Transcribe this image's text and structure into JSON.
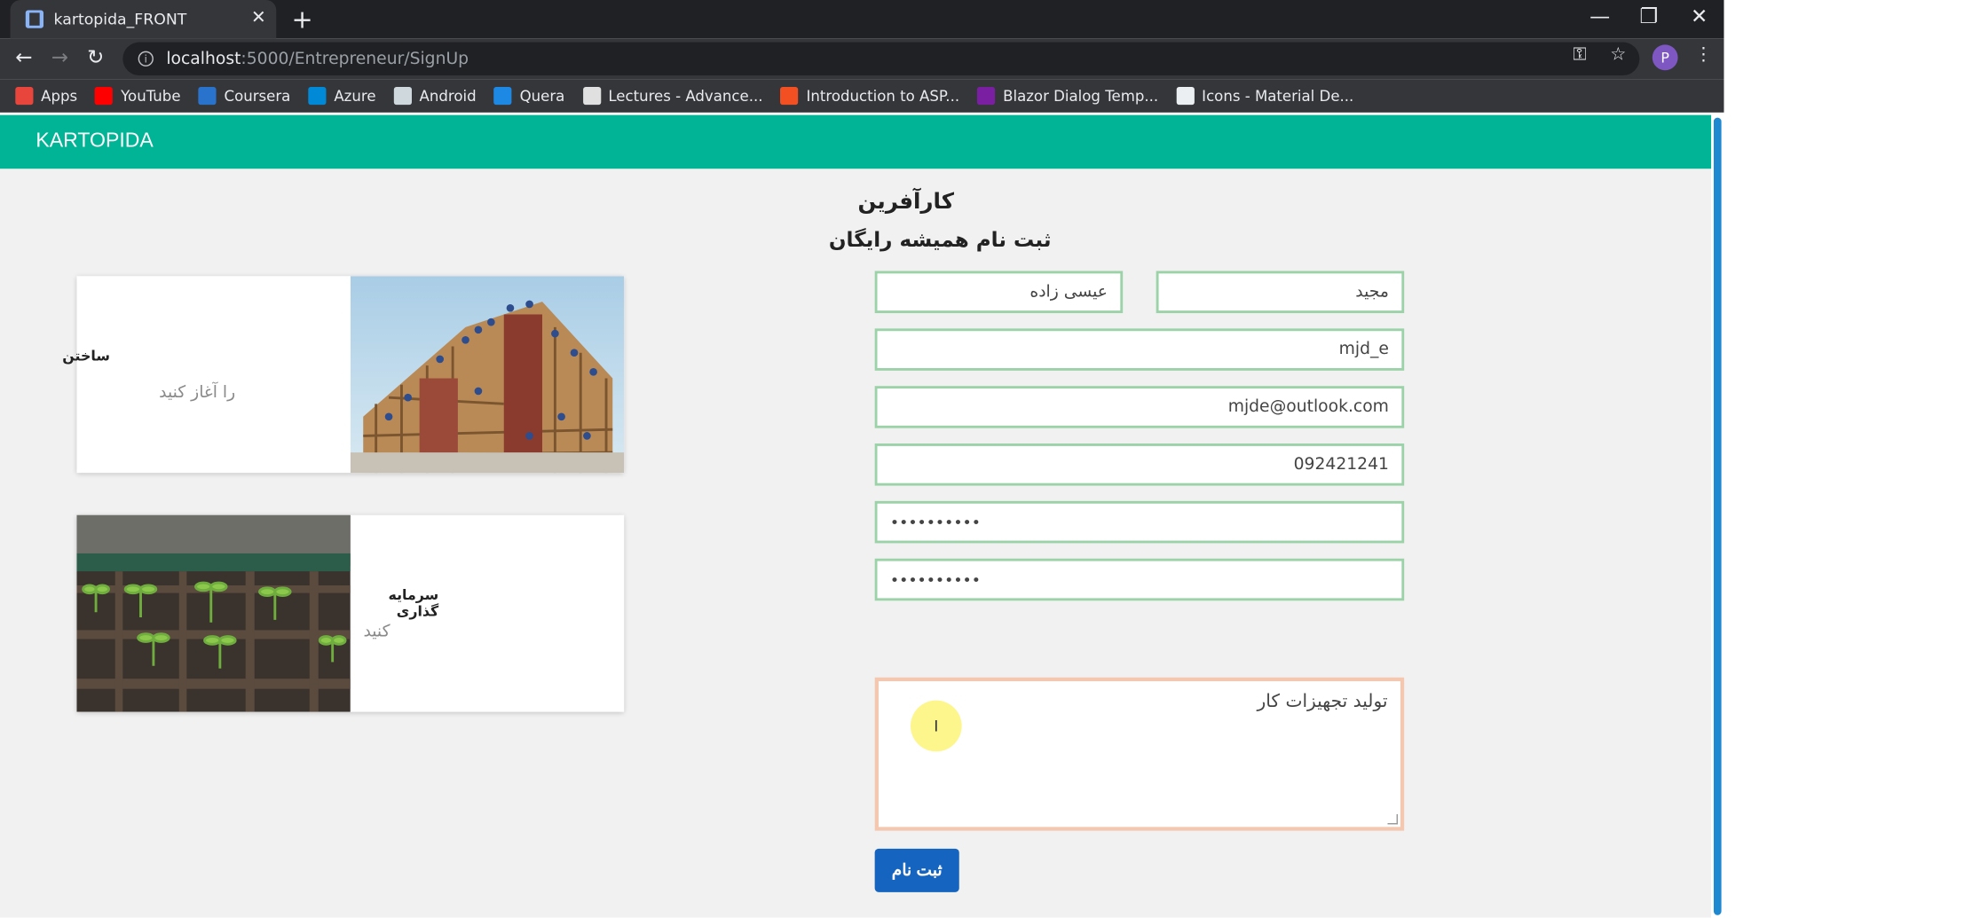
{
  "browser": {
    "tab_title": "kartopida_FRONT",
    "new_tab": "+",
    "url_host": "localhost",
    "url_path": ":5000/Entrepreneur/SignUp",
    "profile_initial": "P",
    "bookmarks": [
      {
        "label": "Apps",
        "icon_color": "#e8453c"
      },
      {
        "label": "YouTube",
        "icon_color": "#ff0000"
      },
      {
        "label": "Coursera",
        "icon_color": "#2a73cc"
      },
      {
        "label": "Azure",
        "icon_color": "#0089d6"
      },
      {
        "label": "Android",
        "icon_color": "#cfd8dc"
      },
      {
        "label": "Quera",
        "icon_color": "#1e88e5"
      },
      {
        "label": "Lectures - Advance...",
        "icon_color": "#e0e0e0"
      },
      {
        "label": "Introduction to ASP...",
        "icon_color": "#f25022"
      },
      {
        "label": "Blazor Dialog Temp...",
        "icon_color": "#7b1fa2"
      },
      {
        "label": "Icons - Material De...",
        "icon_color": "#eceff1"
      }
    ]
  },
  "app": {
    "brand": "KARTOPIDA",
    "brand_color": "#00b495",
    "accent_color": "#1565c0"
  },
  "cards": [
    {
      "title": "ساختن",
      "subtitle": "را آغاز کنید"
    },
    {
      "title": "سرمایه گذاری",
      "subtitle": "کنید"
    }
  ],
  "form": {
    "heading": "کارآفرین",
    "subheading": "ثبت نام همیشه رایگان",
    "first_name": "مجید",
    "last_name": "عیسی زاده",
    "username": "mjd_e",
    "email": "mjde@outlook.com",
    "phone": "092421241",
    "password": "••••••••••",
    "confirm_password": "••••••••••",
    "description": "تولید تجهیزات کار",
    "submit_label": "ثبت نام"
  }
}
